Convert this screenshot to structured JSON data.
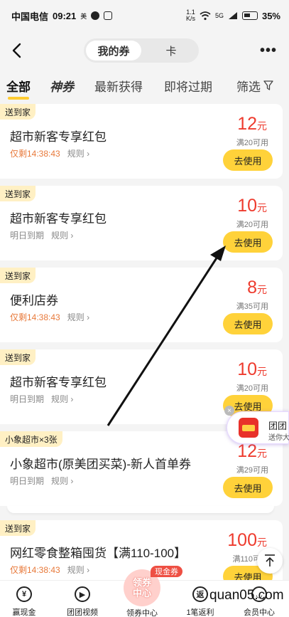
{
  "status_bar": {
    "carrier": "中国电信",
    "time": "09:21",
    "app_indicator": "美",
    "net_speed_top": "1.1",
    "net_speed_bottom": "K/s",
    "signal": "5G",
    "battery": "35%"
  },
  "nav": {
    "segments": [
      {
        "label": "我的券",
        "active": true
      },
      {
        "label": "卡",
        "active": false
      }
    ],
    "more": "•••"
  },
  "tabs": [
    {
      "label": "全部",
      "active": true
    },
    {
      "label": "神券"
    },
    {
      "label": "最新获得"
    },
    {
      "label": "即将过期"
    },
    {
      "label": "筛选"
    }
  ],
  "coupons": [
    {
      "tag": "送到家",
      "title": "超市新客专享红包",
      "expiry": "仅剩14:38:43",
      "expiry_warn": true,
      "rule": "规则",
      "amount": "12",
      "unit": "元",
      "condition": "满20可用",
      "action": "去使用"
    },
    {
      "tag": "送到家",
      "title": "超市新客专享红包",
      "expiry": "明日到期",
      "expiry_warn": false,
      "rule": "规则",
      "amount": "10",
      "unit": "元",
      "condition": "满20可用",
      "action": "去使用"
    },
    {
      "tag": "送到家",
      "title": "便利店券",
      "expiry": "仅剩14:38:43",
      "expiry_warn": true,
      "rule": "规则",
      "amount": "8",
      "unit": "元",
      "condition": "满35可用",
      "action": "去使用"
    },
    {
      "tag": "送到家",
      "title": "超市新客专享红包",
      "expiry": "明日到期",
      "expiry_warn": false,
      "rule": "规则",
      "amount": "10",
      "unit": "元",
      "condition": "满20可用",
      "action": "去使用"
    },
    {
      "tag": "小象超市×3张",
      "title": "小象超市(原美团买菜)-新人首单券",
      "expiry": "明日到期",
      "expiry_warn": false,
      "rule": "规则",
      "amount": "12",
      "unit": "元",
      "condition": "满29可用",
      "action": "去使用"
    },
    {
      "tag": "送到家",
      "title": "网红零食整箱囤货【满110-100】",
      "expiry": "仅剩14:38:43",
      "expiry_warn": true,
      "rule": "规则",
      "amount": "100",
      "unit": "元",
      "condition": "满110可用",
      "action": "去使用"
    }
  ],
  "float_ad": {
    "title": "团团",
    "subtitle": "送你大",
    "close": "×"
  },
  "bottom_nav": {
    "items": [
      {
        "label": "赢现金",
        "icon_char": "¥"
      },
      {
        "label": "团团视频",
        "icon_char": "▶"
      },
      {
        "label": "1笔返利",
        "icon_char": "返"
      },
      {
        "label": "会员中心",
        "icon_char": "◡"
      }
    ],
    "center": {
      "line1": "领券",
      "line2": "中心",
      "badge": "现金券",
      "label": "领券中心"
    }
  },
  "watermark": "quan05.com",
  "colors": {
    "accent": "#ffd23a",
    "price": "#ee3b2e",
    "warn": "#e8793a",
    "tag_bg": "#fff0c4"
  }
}
